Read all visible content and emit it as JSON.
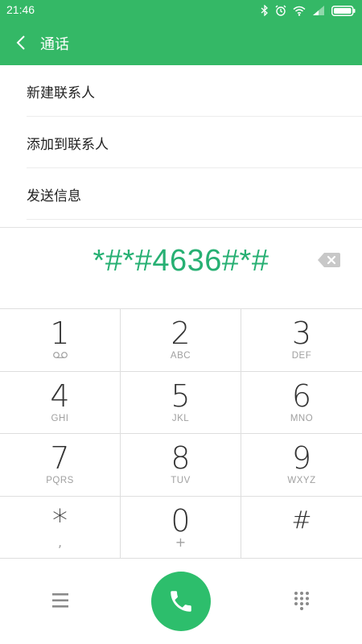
{
  "status_bar": {
    "time": "21:46",
    "icons": [
      "bluetooth-icon",
      "alarm-icon",
      "wifi-icon",
      "signal-icon",
      "battery-icon"
    ]
  },
  "app_bar": {
    "back_icon": "chevron-left-icon",
    "title": "通话"
  },
  "menu": {
    "items": [
      {
        "label": "新建联系人"
      },
      {
        "label": "添加到联系人"
      },
      {
        "label": "发送信息"
      }
    ]
  },
  "dial_input": {
    "number": "*#*#4636#*#",
    "backspace_icon": "backspace-icon"
  },
  "keypad": {
    "keys": [
      {
        "digit": "1",
        "sub": "voicemail-icon"
      },
      {
        "digit": "2",
        "sub": "ABC"
      },
      {
        "digit": "3",
        "sub": "DEF"
      },
      {
        "digit": "4",
        "sub": "GHI"
      },
      {
        "digit": "5",
        "sub": "JKL"
      },
      {
        "digit": "6",
        "sub": "MNO"
      },
      {
        "digit": "7",
        "sub": "PQRS"
      },
      {
        "digit": "8",
        "sub": "TUV"
      },
      {
        "digit": "9",
        "sub": "WXYZ"
      },
      {
        "digit": "*",
        "sub": ","
      },
      {
        "digit": "0",
        "sub": "+"
      },
      {
        "digit": "#",
        "sub": ""
      }
    ]
  },
  "bottom_bar": {
    "menu_icon": "hamburger-menu-icon",
    "call_icon": "phone-icon",
    "dialpad_icon": "dialpad-icon"
  },
  "colors": {
    "accent": "#34b866",
    "dial_number": "#27b073",
    "call_button": "#2dbe6c"
  }
}
